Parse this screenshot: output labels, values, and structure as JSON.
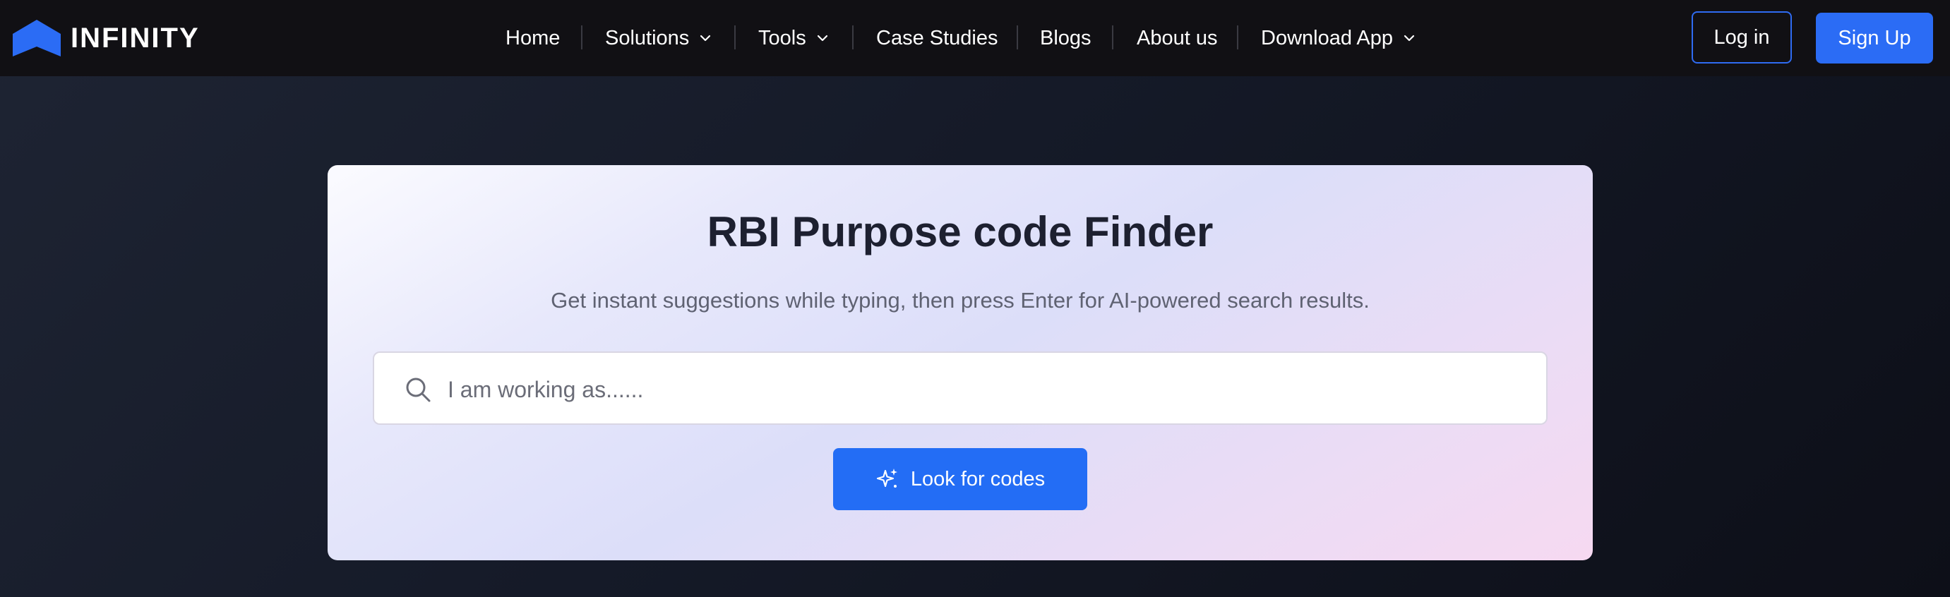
{
  "brand": {
    "name": "INFINITY",
    "logo_icon": "infinity-chevron-logo",
    "color": "#2b6cf5"
  },
  "nav": {
    "items": [
      {
        "label": "Home",
        "has_dropdown": false
      },
      {
        "label": "Solutions",
        "has_dropdown": true
      },
      {
        "label": "Tools",
        "has_dropdown": true
      },
      {
        "label": "Case Studies",
        "has_dropdown": false
      },
      {
        "label": "Blogs",
        "has_dropdown": false
      },
      {
        "label": "About us",
        "has_dropdown": false
      },
      {
        "label": "Download App",
        "has_dropdown": true
      }
    ],
    "login_label": "Log in",
    "signup_label": "Sign Up"
  },
  "finder": {
    "title": "RBI Purpose code Finder",
    "subtitle": "Get instant suggestions while typing, then press Enter for AI-powered search results.",
    "search": {
      "placeholder": "I am working as......",
      "value": "",
      "icon": "search-icon"
    },
    "button_label": "Look for codes",
    "button_icon": "sparkle-icon"
  },
  "colors": {
    "accent": "#2b6cf5",
    "nav_bg": "#111014",
    "title": "#1d2030",
    "subtitle": "#5f6272"
  }
}
